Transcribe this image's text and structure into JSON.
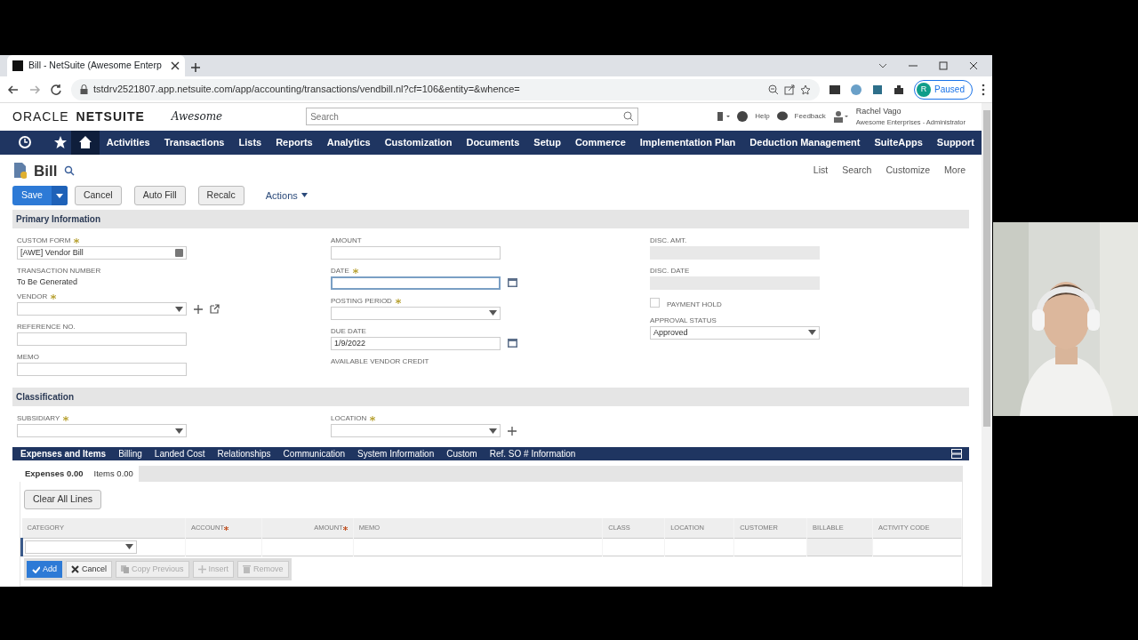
{
  "browser": {
    "tab_title": "Bill - NetSuite (Awesome Enterp",
    "url": "tstdrv2521807.app.netsuite.com/app/accounting/transactions/vendbill.nl?cf=106&entity=&whence=",
    "profile_initial": "R",
    "profile_status": "Paused"
  },
  "header": {
    "logo_oracle": "ORACLE",
    "logo_netsuite": "NETSUITE",
    "company_logo": "Awesome",
    "search": {
      "placeholder": "Search"
    },
    "help": "Help",
    "feedback": "Feedback",
    "user_name": "Rachel Vago",
    "user_role": "Awesome Enterprises - Administrator"
  },
  "nav": {
    "items": [
      {
        "label": "Activities"
      },
      {
        "label": "Transactions"
      },
      {
        "label": "Lists"
      },
      {
        "label": "Reports"
      },
      {
        "label": "Analytics"
      },
      {
        "label": "Customization"
      },
      {
        "label": "Documents"
      },
      {
        "label": "Setup"
      },
      {
        "label": "Commerce"
      },
      {
        "label": "Implementation Plan"
      },
      {
        "label": "Deduction Management"
      },
      {
        "label": "SuiteApps"
      },
      {
        "label": "Support"
      }
    ]
  },
  "page": {
    "title": "Bill",
    "links": [
      "List",
      "Search",
      "Customize",
      "More"
    ],
    "buttons": [
      {
        "label": "Save",
        "kind": "primary"
      },
      {
        "label": "Cancel",
        "kind": "plain"
      },
      {
        "label": "Auto Fill",
        "kind": "plain"
      },
      {
        "label": "Recalc",
        "kind": "plain"
      }
    ],
    "actions": "Actions"
  },
  "sections": [
    {
      "title": "Primary Information",
      "columns": [
        [
          {
            "label": "CUSTOM FORM",
            "required": true,
            "kind": "form-select",
            "value": "[AWE] Vendor Bill"
          },
          {
            "label": "TRANSACTION NUMBER",
            "required": false,
            "kind": "readonly",
            "value": "To Be Generated"
          },
          {
            "label": "VENDOR",
            "required": true,
            "kind": "select-add"
          },
          {
            "label": "REFERENCE NO.",
            "required": false,
            "kind": "text"
          },
          {
            "label": "MEMO",
            "required": false,
            "kind": "text"
          }
        ],
        [
          {
            "label": "AMOUNT",
            "required": false,
            "kind": "text"
          },
          {
            "label": "DATE",
            "required": true,
            "kind": "date",
            "focused": true
          },
          {
            "label": "POSTING PERIOD",
            "required": true,
            "kind": "select"
          },
          {
            "label": "DUE DATE",
            "required": false,
            "kind": "date",
            "value": "1/9/2022"
          },
          {
            "label": "AVAILABLE VENDOR CREDIT",
            "required": false,
            "kind": "readonly"
          }
        ],
        [
          {
            "label": "DISC. AMT.",
            "required": false,
            "kind": "disabled"
          },
          {
            "label": "DISC. DATE",
            "required": false,
            "kind": "disabled"
          },
          {
            "label": "PAYMENT HOLD",
            "kind": "checkbox",
            "checked": false
          },
          {
            "label": "APPROVAL STATUS",
            "required": false,
            "kind": "select",
            "value": "Approved"
          }
        ]
      ]
    },
    {
      "title": "Classification",
      "columns": [
        [
          {
            "label": "SUBSIDIARY",
            "required": true,
            "kind": "select"
          }
        ],
        [
          {
            "label": "LOCATION",
            "required": true,
            "kind": "select-plus"
          }
        ],
        []
      ]
    }
  ],
  "subtabs": [
    {
      "label": "Expenses and Items",
      "selected": true
    },
    {
      "label": "Billing",
      "selected": false
    },
    {
      "label": "Landed Cost",
      "selected": false
    },
    {
      "label": "Relationships",
      "selected": false
    },
    {
      "label": "Communication",
      "selected": false
    },
    {
      "label": "System Information",
      "selected": false
    },
    {
      "label": "Custom",
      "selected": false
    },
    {
      "label": "Ref. SO # Information",
      "selected": false
    }
  ],
  "sublist": {
    "tabs": [
      {
        "label": "Expenses 0.00",
        "selected": true
      },
      {
        "label": "Items 0.00",
        "selected": false
      }
    ],
    "clear_button": "Clear All Lines",
    "columns": [
      {
        "label": "CATEGORY",
        "required": false
      },
      {
        "label": "ACCOUNT",
        "required": true
      },
      {
        "label": "AMOUNT",
        "required": true
      },
      {
        "label": "MEMO",
        "required": false
      },
      {
        "label": "CLASS",
        "required": false
      },
      {
        "label": "LOCATION",
        "required": false
      },
      {
        "label": "CUSTOMER",
        "required": false
      },
      {
        "label": "BILLABLE",
        "required": false
      },
      {
        "label": "ACTIVITY CODE",
        "required": false
      }
    ],
    "row_buttons": [
      {
        "label": "Add",
        "kind": "check",
        "disabled": false
      },
      {
        "label": "Cancel",
        "kind": "cross",
        "disabled": false
      },
      {
        "label": "Copy Previous",
        "kind": "copy",
        "disabled": true
      },
      {
        "label": "Insert",
        "kind": "plus",
        "disabled": true
      },
      {
        "label": "Remove",
        "kind": "trash",
        "disabled": true
      }
    ]
  }
}
